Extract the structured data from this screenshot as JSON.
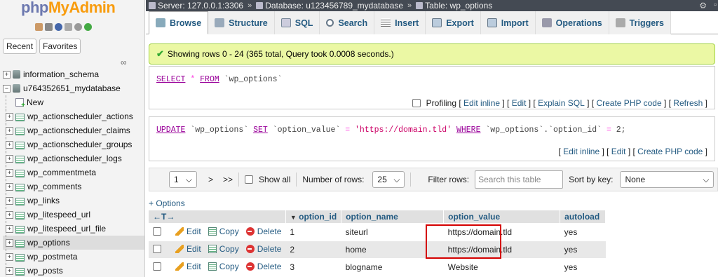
{
  "logo": {
    "php": "php",
    "myadmin": "MyAdmin"
  },
  "sidebar": {
    "tabs": [
      "Recent",
      "Favorites"
    ],
    "tree": [
      {
        "label": "information_schema",
        "type": "db",
        "level": 0
      },
      {
        "label": "u764352651_mydatabase",
        "type": "db",
        "level": 0
      },
      {
        "label": "New",
        "type": "new",
        "level": 1
      },
      {
        "label": "wp_actionscheduler_actions",
        "type": "table",
        "level": 1
      },
      {
        "label": "wp_actionscheduler_claims",
        "type": "table",
        "level": 1
      },
      {
        "label": "wp_actionscheduler_groups",
        "type": "table",
        "level": 1
      },
      {
        "label": "wp_actionscheduler_logs",
        "type": "table",
        "level": 1
      },
      {
        "label": "wp_commentmeta",
        "type": "table",
        "level": 1
      },
      {
        "label": "wp_comments",
        "type": "table",
        "level": 1
      },
      {
        "label": "wp_links",
        "type": "table",
        "level": 1
      },
      {
        "label": "wp_litespeed_url",
        "type": "table",
        "level": 1
      },
      {
        "label": "wp_litespeed_url_file",
        "type": "table",
        "level": 1
      },
      {
        "label": "wp_options",
        "type": "table",
        "level": 1,
        "selected": true
      },
      {
        "label": "wp_postmeta",
        "type": "table",
        "level": 1
      },
      {
        "label": "wp_posts",
        "type": "table",
        "level": 1
      }
    ]
  },
  "breadcrumb": {
    "server": "Server: 127.0.0.1:3306",
    "database": "Database: u123456789_mydatabase",
    "table": "Table: wp_options"
  },
  "tabs": [
    "Browse",
    "Structure",
    "SQL",
    "Search",
    "Insert",
    "Export",
    "Import",
    "Operations",
    "Triggers"
  ],
  "success_message": "Showing rows 0 - 24 (365 total, Query took 0.0008 seconds.)",
  "select_query": {
    "kw1": "SELECT",
    "star": "*",
    "kw2": "FROM",
    "table": "`wp_options`"
  },
  "select_tools": {
    "profiling": "Profiling",
    "edit_inline": "Edit inline",
    "edit": "Edit",
    "explain": "Explain SQL",
    "create_php": "Create PHP code",
    "refresh": "Refresh"
  },
  "update_query": {
    "kw1": "UPDATE",
    "table": "`wp_options`",
    "kw2": "SET",
    "col": "`option_value`",
    "eq": "=",
    "value": "'https://domain.tld'",
    "kw3": "WHERE",
    "where_lhs": "`wp_options`.`option_id`",
    "eq2": "=",
    "num": "2;"
  },
  "update_tools": {
    "edit_inline": "Edit inline",
    "edit": "Edit",
    "create_php": "Create PHP code"
  },
  "nav": {
    "page": "1",
    "next": ">",
    "last": ">>",
    "show_all": "Show all",
    "num_rows_label": "Number of rows:",
    "num_rows": "25",
    "filter_label": "Filter rows:",
    "filter_placeholder": "Search this table",
    "sort_label": "Sort by key:",
    "sort_value": "None"
  },
  "options_link": "+ Options",
  "table": {
    "headers": [
      "option_id",
      "option_name",
      "option_value",
      "autoload"
    ],
    "actions": {
      "edit": "Edit",
      "copy": "Copy",
      "delete": "Delete"
    },
    "rows": [
      {
        "option_id": "1",
        "option_name": "siteurl",
        "option_value": "https://domain.tld",
        "autoload": "yes"
      },
      {
        "option_id": "2",
        "option_name": "home",
        "option_value": "https://domain.tld",
        "autoload": "yes"
      },
      {
        "option_id": "3",
        "option_name": "blogname",
        "option_value": "Website",
        "autoload": "yes"
      }
    ]
  },
  "colors": {
    "link": "#235a81",
    "highlight_box": "#d40000",
    "success_bg": "#ebf8a4",
    "topbar_bg": "#444a53"
  }
}
